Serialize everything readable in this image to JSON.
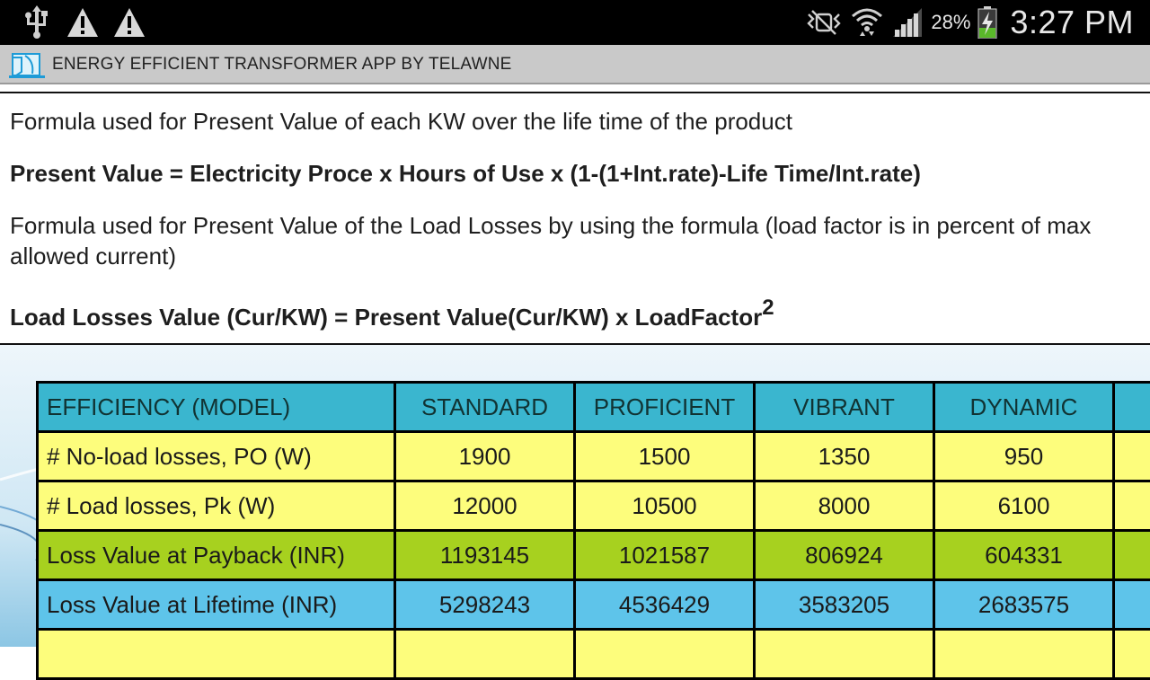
{
  "status_bar": {
    "battery_percent": "28%",
    "time": "3:27 PM",
    "icons": [
      "usb-icon",
      "warning-icon",
      "warning-icon",
      "mute-icon",
      "wifi-icon",
      "signal-icon",
      "battery-charging-icon"
    ]
  },
  "app_bar": {
    "title": "ENERGY EFFICIENT TRANSFORMER APP BY TELAWNE",
    "icon": "app-logo-icon"
  },
  "content": {
    "line1": "Formula used for Present Value of each KW over the life time of the product",
    "line2": "Present Value = Electricity Proce x Hours of Use x (1-(1+Int.rate)-Life Time/Int.rate)",
    "line3": "Formula used for Present Value of the Load Losses by using the formula (load factor is in percent of max allowed current)",
    "line4": "Load Losses Value (Cur/KW) = Present Value(Cur/KW) x LoadFactor",
    "line4_sup": "2"
  },
  "table": {
    "headers": [
      "EFFICIENCY (MODEL)",
      "STANDARD",
      "PROFICIENT",
      "VIBRANT",
      "DYNAMIC",
      ""
    ],
    "rows": [
      {
        "label": "# No-load losses, PO (W)",
        "values": [
          "1900",
          "1500",
          "1350",
          "950",
          ""
        ]
      },
      {
        "label": "# Load losses, Pk (W)",
        "values": [
          "12000",
          "10500",
          "8000",
          "6100",
          ""
        ]
      },
      {
        "label": "Loss Value at Payback (INR)",
        "values": [
          "1193145",
          "1021587",
          "806924",
          "604331",
          ""
        ]
      },
      {
        "label": "Loss Value at Lifetime (INR)",
        "values": [
          "5298243",
          "4536429",
          "3583205",
          "2683575",
          ""
        ]
      },
      {
        "label": "",
        "values": [
          "",
          "",
          "",
          "",
          ""
        ]
      }
    ]
  },
  "colors": {
    "header": "#3ab6cf",
    "yellow_row": "#fdfd7c",
    "green_row": "#a7d11f",
    "blue_row": "#5ec4ea"
  }
}
